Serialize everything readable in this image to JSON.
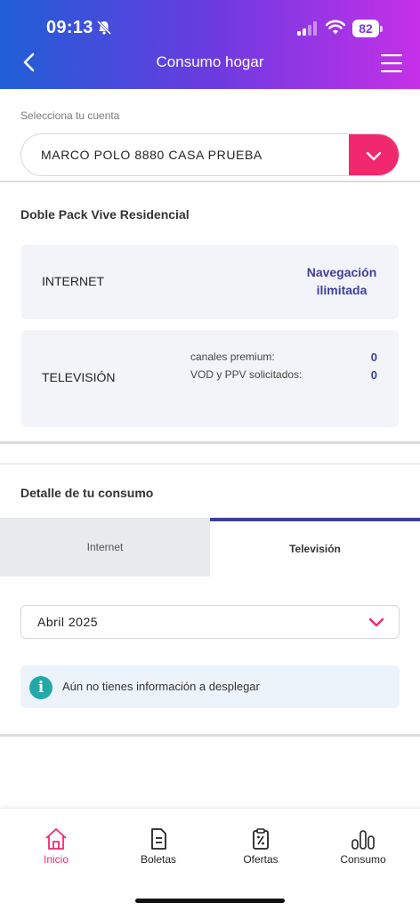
{
  "status": {
    "time": "09:13",
    "battery": "82"
  },
  "header": {
    "title": "Consumo hogar"
  },
  "account": {
    "label": "Selecciona tu cuenta",
    "value": "MARCO POLO 8880 CASA PRUEBA"
  },
  "plan": {
    "title": "Doble Pack Vive Residencial",
    "internet": {
      "label": "INTERNET",
      "value_line1": "Navegación",
      "value_line2": "ilimitada"
    },
    "tv": {
      "label": "TELEVISIÓN",
      "rows": [
        {
          "label": "canales premium:",
          "value": "0"
        },
        {
          "label": "VOD y PPV solicitados:",
          "value": "0"
        }
      ]
    }
  },
  "detail": {
    "title": "Detalle de tu consumo",
    "tabs": [
      {
        "label": "Internet",
        "active": false
      },
      {
        "label": "Televisión",
        "active": true
      }
    ],
    "month": "Abril 2025",
    "info": "Aún no tienes información a desplegar"
  },
  "bottom_nav": [
    {
      "label": "Inicio",
      "icon": "home-icon",
      "active": true
    },
    {
      "label": "Boletas",
      "icon": "document-icon",
      "active": false
    },
    {
      "label": "Ofertas",
      "icon": "offers-icon",
      "active": false
    },
    {
      "label": "Consumo",
      "icon": "bar-chart-icon",
      "active": false
    }
  ],
  "colors": {
    "accent": "#f2286e",
    "primary": "#3d3f9a",
    "info": "#22a8a8"
  }
}
